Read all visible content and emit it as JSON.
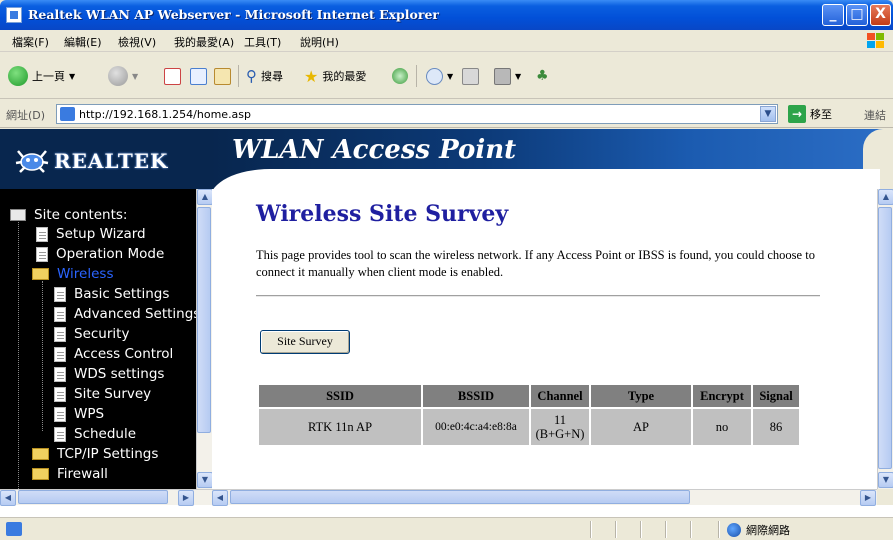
{
  "window": {
    "title": "Realtek WLAN AP Webserver - Microsoft Internet Explorer",
    "buttons": {
      "minimize": "_",
      "maximize": "□",
      "close": "X"
    }
  },
  "menu": {
    "items": [
      "檔案(F)",
      "編輯(E)",
      "檢視(V)",
      "我的最愛(A)",
      "工具(T)",
      "說明(H)"
    ]
  },
  "toolbar": {
    "back_label": "上一頁",
    "search_label": "搜尋",
    "favorites_label": "我的最愛"
  },
  "address": {
    "label": "網址(D)",
    "url": "http://192.168.1.254/home.asp",
    "go_label": "移至",
    "links_label": "連結"
  },
  "banner": {
    "logo_text": "REALTEK",
    "title": "WLAN Access Point"
  },
  "nav": {
    "root_label": "Site contents:",
    "items": [
      {
        "label": "Setup Wizard",
        "level": 1,
        "icon": "document-icon"
      },
      {
        "label": "Operation Mode",
        "level": 1,
        "icon": "document-icon"
      },
      {
        "label": "Wireless",
        "level": 1,
        "icon": "folder-open-icon",
        "active": true
      },
      {
        "label": "Basic Settings",
        "level": 2,
        "icon": "document-icon"
      },
      {
        "label": "Advanced Settings",
        "level": 2,
        "icon": "document-icon"
      },
      {
        "label": "Security",
        "level": 2,
        "icon": "document-icon"
      },
      {
        "label": "Access Control",
        "level": 2,
        "icon": "document-icon"
      },
      {
        "label": "WDS settings",
        "level": 2,
        "icon": "document-icon"
      },
      {
        "label": "Site Survey",
        "level": 2,
        "icon": "document-icon"
      },
      {
        "label": "WPS",
        "level": 2,
        "icon": "document-icon"
      },
      {
        "label": "Schedule",
        "level": 2,
        "icon": "document-icon"
      },
      {
        "label": "TCP/IP Settings",
        "level": 1,
        "icon": "folder-icon"
      },
      {
        "label": "Firewall",
        "level": 1,
        "icon": "folder-icon"
      }
    ]
  },
  "main": {
    "heading": "Wireless Site Survey",
    "description": "This page provides tool to scan the wireless network. If any Access Point or IBSS is found, you could choose to connect it manually when client mode is enabled.",
    "survey_button": "Site Survey",
    "table": {
      "headers": [
        "SSID",
        "BSSID",
        "Channel",
        "Type",
        "Encrypt",
        "Signal"
      ],
      "rows": [
        {
          "ssid": "RTK 11n AP",
          "bssid": "00:e0:4c:a4:e8:8a",
          "channel": "11",
          "channel_mode": "(B+G+N)",
          "type": "AP",
          "encrypt": "no",
          "signal": "86"
        }
      ]
    }
  },
  "status": {
    "zone": "網際網路"
  },
  "colors": {
    "titlebar": "#0250d8",
    "banner": "#08264e",
    "heading": "#1f1fa0",
    "nav_active": "#2a64ff",
    "table_header": "#808080",
    "table_cell": "#c0c0c0"
  }
}
